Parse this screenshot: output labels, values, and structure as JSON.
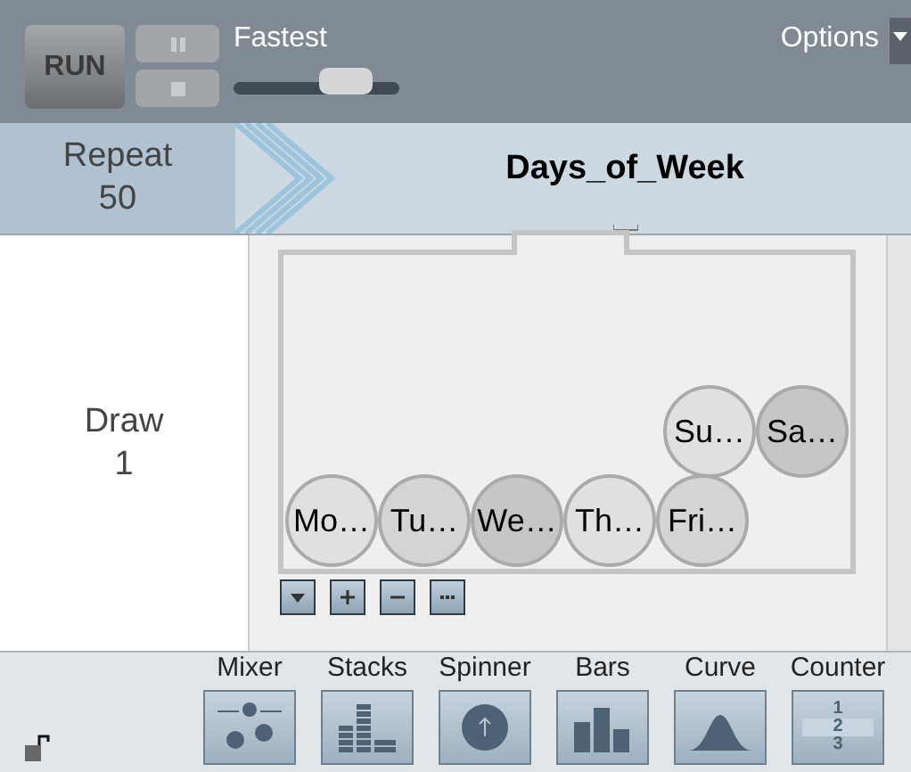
{
  "toolbar": {
    "run": "RUN",
    "speed_label": "Fastest",
    "speed": {
      "level": 0.68
    },
    "options": "Options"
  },
  "header": {
    "repeat_label": "Repeat",
    "repeat_count": "50",
    "title": "Days_of_Week"
  },
  "draw": {
    "label": "Draw",
    "count": "1"
  },
  "mixer": {
    "top_row": [
      {
        "label": "Su…",
        "color": "#e0e0e0"
      },
      {
        "label": "Sa…",
        "color": "#c6c6c6"
      }
    ],
    "bottom_row": [
      {
        "label": "Mo…",
        "color": "#e0e0e0"
      },
      {
        "label": "Tu…",
        "color": "#d4d4d4"
      },
      {
        "label": "We…",
        "color": "#c6c6c6"
      },
      {
        "label": "Th…",
        "color": "#e0e0e0"
      },
      {
        "label": "Fri…",
        "color": "#d4d4d4"
      }
    ],
    "buttons": [
      {
        "kind": "dropdown"
      },
      {
        "kind": "add"
      },
      {
        "kind": "remove"
      },
      {
        "kind": "more"
      }
    ]
  },
  "devices": [
    {
      "label": "Mixer",
      "kind": "mixer"
    },
    {
      "label": "Stacks",
      "kind": "stacks"
    },
    {
      "label": "Spinner",
      "kind": "spinner"
    },
    {
      "label": "Bars",
      "kind": "bars"
    },
    {
      "label": "Curve",
      "kind": "curve"
    },
    {
      "label": "Counter",
      "kind": "counter",
      "digits": [
        "1",
        "2",
        "3"
      ]
    }
  ],
  "locked": false
}
